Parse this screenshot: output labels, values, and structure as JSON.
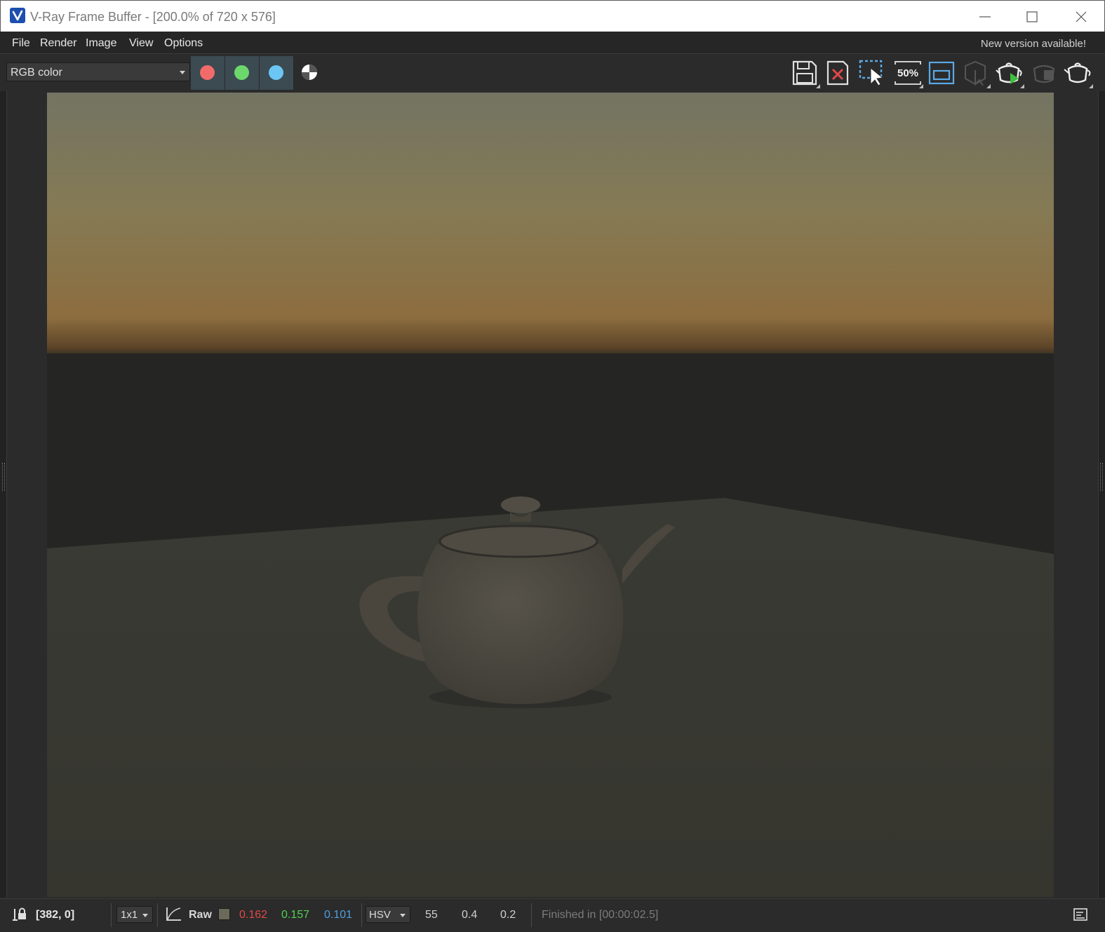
{
  "window": {
    "title": "V-Ray Frame Buffer - [200.0% of 720 x 576]",
    "icon": "vray-logo-icon"
  },
  "menu": {
    "file": "File",
    "render": "Render",
    "image": "Image",
    "view": "View",
    "options": "Options",
    "notice": "New version available!"
  },
  "toolbar": {
    "channel": "RGB color",
    "channel_buttons": [
      {
        "name": "red-channel",
        "color": "#f26b6b"
      },
      {
        "name": "green-channel",
        "color": "#6cd86c"
      },
      {
        "name": "blue-channel",
        "color": "#6cc6f4"
      }
    ],
    "alpha_icon": "alpha-channel-icon",
    "zoom_label": "50%",
    "right_icons": [
      "save-icon",
      "clear-image-icon",
      "region-render-icon",
      "zoom-50-icon",
      "track-mouse-icon",
      "interactive-render-icon",
      "render-production-icon",
      "stop-render-icon",
      "render-teapot-icon"
    ]
  },
  "colors": {
    "accent_blue": "#5aa9e6",
    "render_green": "#3fbf3f",
    "red_value": "#e04848",
    "green_value": "#4fd24f",
    "blue_value": "#4d9fe0"
  },
  "status": {
    "coords": "[382, 0]",
    "sample": "1x1",
    "mode": "Raw",
    "swatch_color": "#6b6a5a",
    "r": "0.162",
    "g": "0.157",
    "b": "0.101",
    "colorspace": "HSV",
    "h": "55",
    "s": "0.4",
    "v": "0.2",
    "message": "Finished in [00:00:02.5]"
  }
}
